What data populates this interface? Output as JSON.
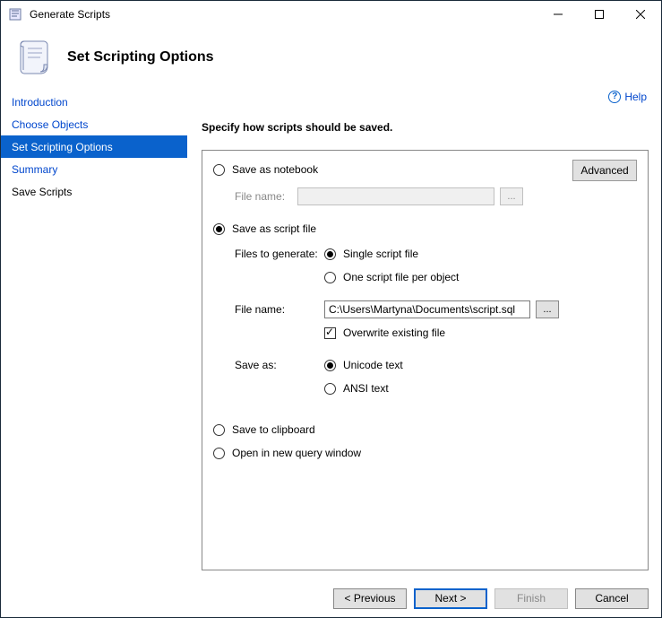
{
  "window": {
    "title": "Generate Scripts"
  },
  "header": {
    "title": "Set Scripting Options"
  },
  "help": {
    "label": "Help"
  },
  "sidebar": {
    "items": [
      {
        "label": "Introduction",
        "link": true,
        "selected": false
      },
      {
        "label": "Choose Objects",
        "link": true,
        "selected": false
      },
      {
        "label": "Set Scripting Options",
        "link": false,
        "selected": true
      },
      {
        "label": "Summary",
        "link": true,
        "selected": false
      },
      {
        "label": "Save Scripts",
        "link": false,
        "selected": false
      }
    ]
  },
  "content": {
    "instruction": "Specify how scripts should be saved.",
    "advanced": "Advanced",
    "opt_notebook": "Save as notebook",
    "notebook_filelabel": "File name:",
    "notebook_filename": "",
    "opt_scriptfile": "Save as script file",
    "files_to_generate": "Files to generate:",
    "single_file": "Single script file",
    "one_per_object": "One script file per object",
    "filename_label": "File name:",
    "filename_value": "C:\\Users\\Martyna\\Documents\\script.sql",
    "overwrite": "Overwrite existing file",
    "saveas_label": "Save as:",
    "unicode": "Unicode text",
    "ansi": "ANSI text",
    "opt_clipboard": "Save to clipboard",
    "opt_newquery": "Open in new query window",
    "browse": "..."
  },
  "footer": {
    "previous": "< Previous",
    "next": "Next >",
    "finish": "Finish",
    "cancel": "Cancel"
  }
}
